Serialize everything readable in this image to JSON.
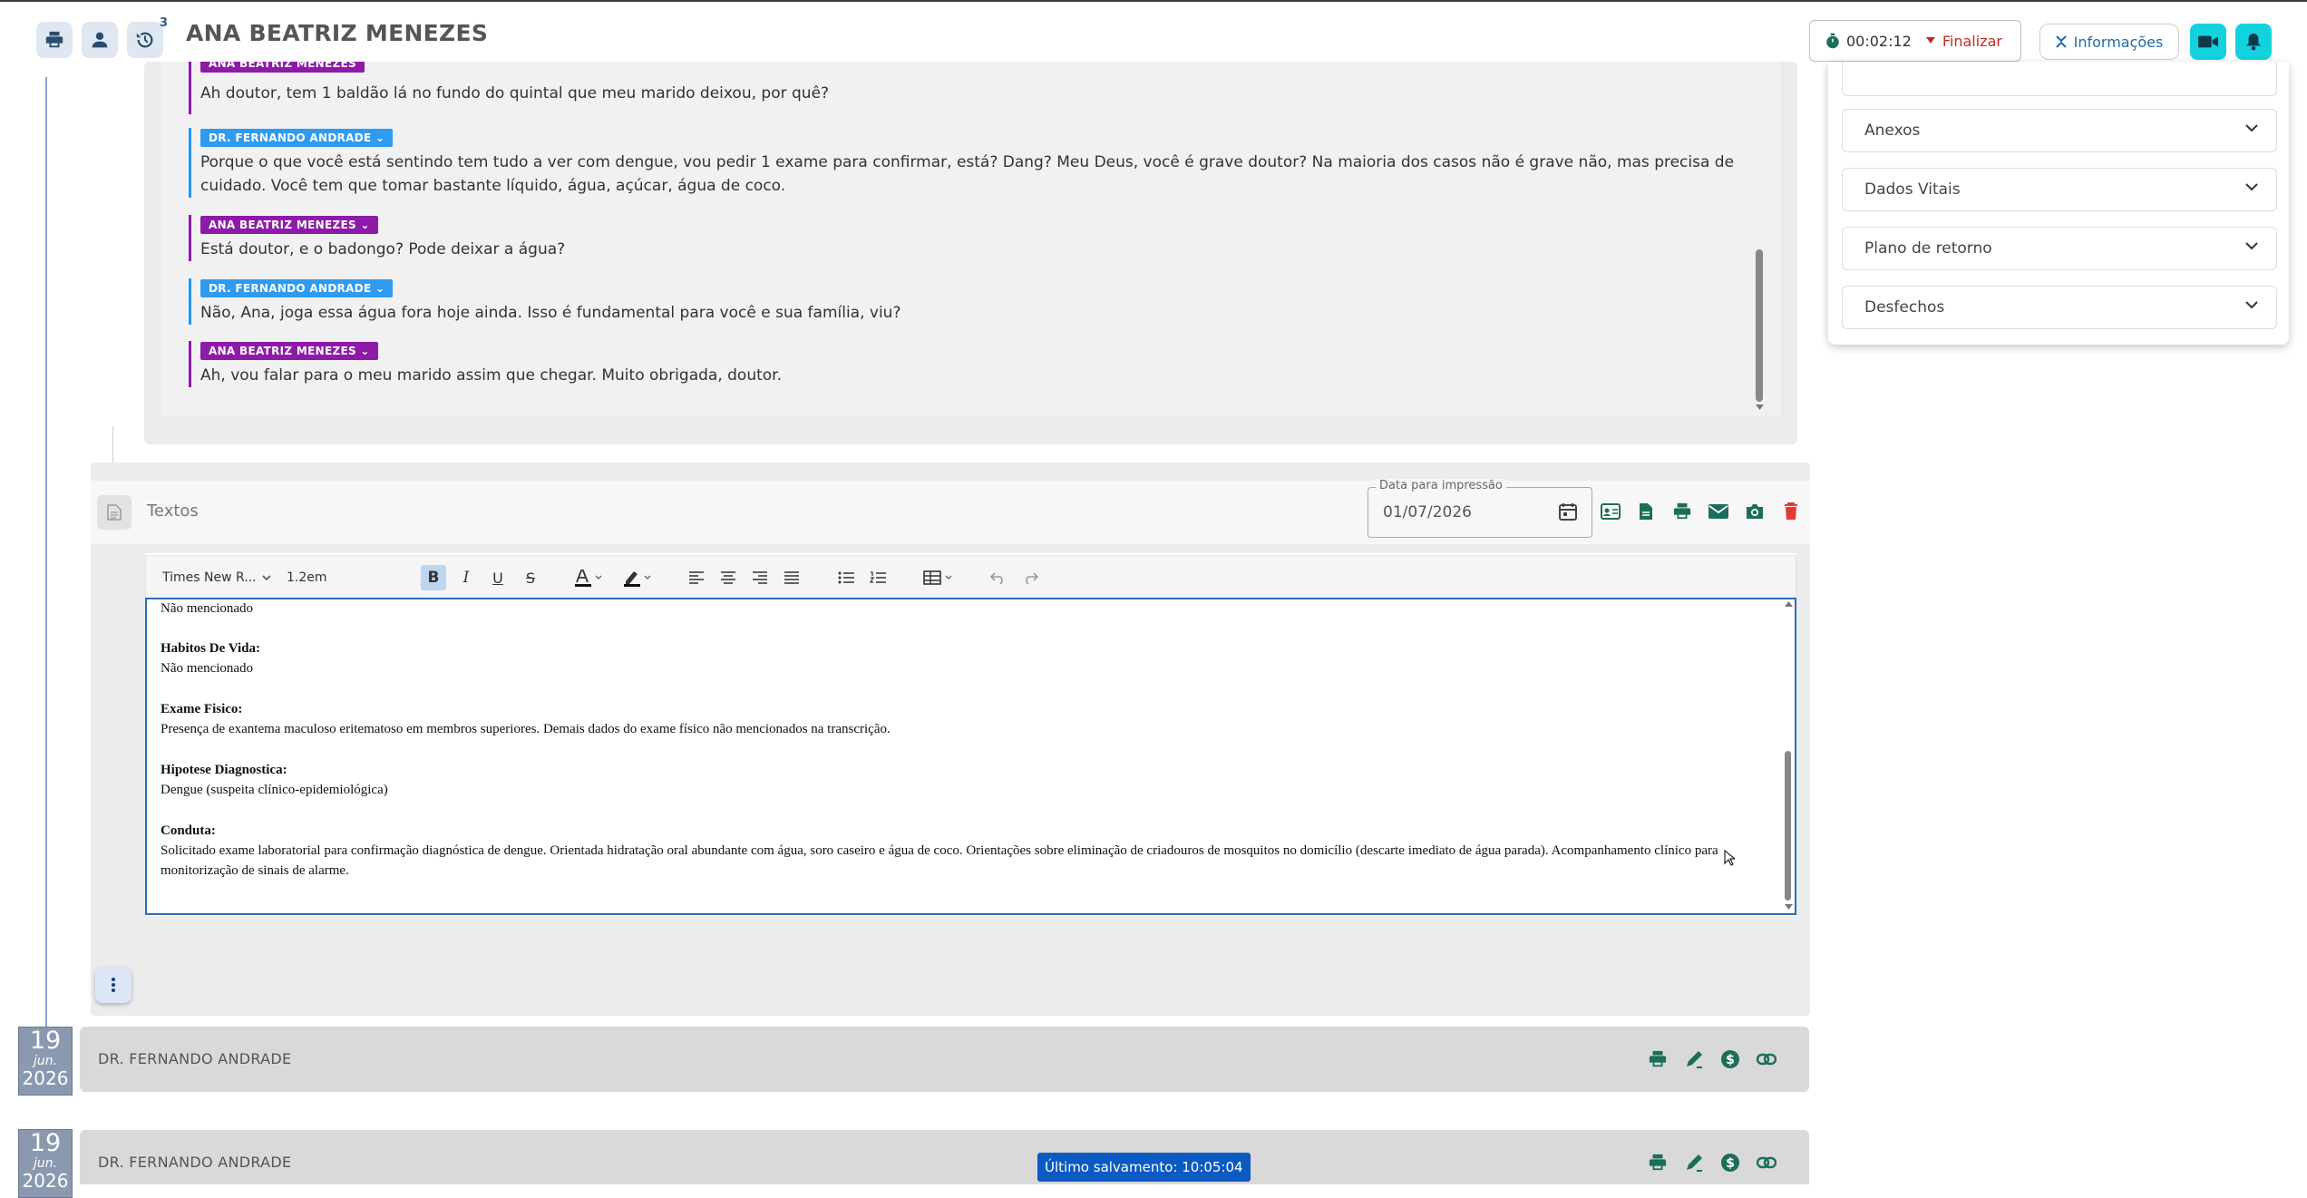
{
  "header": {
    "patient_name": "ANA BEATRIZ MENEZES",
    "history_badge": "3",
    "timer": "00:02:12",
    "finalize_label": "Finalizar",
    "info_label": "Informações"
  },
  "chat": {
    "messages": [
      {
        "speaker": "ANA BEATRIZ MENEZES",
        "role": "patient",
        "text": "Ah doutor, tem 1 baldão lá no fundo do quintal que meu marido deixou, por quê?"
      },
      {
        "speaker": "DR. FERNANDO ANDRADE",
        "role": "doctor",
        "text": "Porque o que você está sentindo tem tudo a ver com dengue, vou pedir 1 exame para confirmar, está? Dang? Meu Deus, você é grave doutor? Na maioria dos casos não é grave não, mas precisa de cuidado. Você tem que tomar bastante líquido, água, açúcar, água de coco."
      },
      {
        "speaker": "ANA BEATRIZ MENEZES",
        "role": "patient",
        "text": "Está doutor, e o badongo? Pode deixar a água?"
      },
      {
        "speaker": "DR. FERNANDO ANDRADE",
        "role": "doctor",
        "text": "Não, Ana, joga essa água fora hoje ainda. Isso é fundamental para você e sua família, viu?"
      },
      {
        "speaker": "ANA BEATRIZ MENEZES",
        "role": "patient",
        "text": "Ah, vou falar para o meu marido assim que chegar. Muito obrigada, doutor."
      }
    ]
  },
  "textos": {
    "label": "Textos",
    "date_label": "Data para impressão",
    "date_value": "01/07/2026"
  },
  "editor": {
    "font_family": "Times New R...",
    "font_size": "1.2em",
    "content": {
      "line0": "Não mencionado",
      "h1": "Habitos De Vida:",
      "p1": "Não mencionado",
      "h2": "Exame Fisico:",
      "p2": "Presença de exantema maculoso eritematoso em membros superiores. Demais dados do exame físico não mencionados na transcrição.",
      "h3": "Hipotese Diagnostica:",
      "p3": "Dengue (suspeita clínico-epidemiológica)",
      "h4": "Conduta:",
      "p4": "Solicitado exame laboratorial para confirmação diagnóstica de dengue. Orientada hidratação oral abundante com água, soro caseiro e água de coco. Orientações sobre eliminação de criadouros de mosquitos no domicílio (descarte imediato de água parada). Acompanhamento clínico para monitorização de sinais de alarme."
    }
  },
  "records": [
    {
      "day": "19",
      "month": "jun.",
      "year": "2026",
      "doctor": "DR. FERNANDO ANDRADE"
    },
    {
      "day": "19",
      "month": "jun.",
      "year": "2026",
      "doctor": "DR. FERNANDO ANDRADE"
    }
  ],
  "last_save": "Último salvamento: 10:05:04",
  "right_panel": {
    "sections": [
      "Anexos",
      "Dados Vitais",
      "Plano de retorno",
      "Desfechos"
    ]
  },
  "colors": {
    "patient_tag": "#8e1ba8",
    "doctor_tag": "#2e9bf0",
    "accent_cyan": "#12d3dd",
    "finalize_red": "#c62828",
    "icon_green": "#1b6e5a",
    "delete_red": "#e53935",
    "save_badge": "#0a5ac2"
  }
}
